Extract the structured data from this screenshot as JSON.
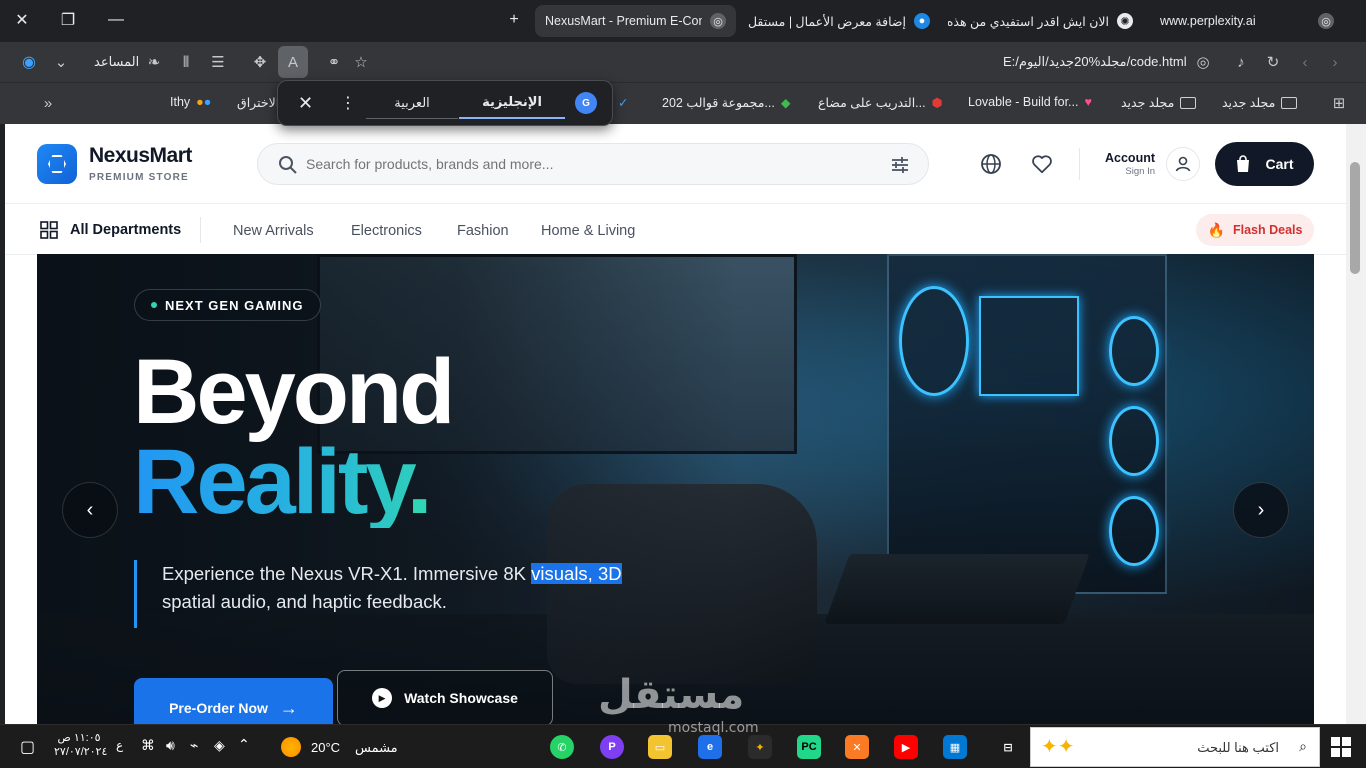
{
  "browser": {
    "tabs": [
      {
        "title": "www.perplexity.ai"
      },
      {
        "title": "الان ايش اقدر استفيدي من هذه"
      },
      {
        "title": "إضافة معرض الأعمال | مستقل"
      },
      {
        "title": "NexusMart - Premium E-Comm"
      }
    ],
    "address": "E:/مجلد%20جديد/اليوم/code.html",
    "assistant_label": "المساعد",
    "bookmarks": [
      "مجلد جديد",
      "مجلد جديد",
      "Lovable - Build for...",
      "التدريب على مضاع...",
      "مجموعة قوالب 202...",
      "الاختراق",
      "Ithy"
    ],
    "translate": {
      "active_lang": "الإنجليزية",
      "other_lang": "العربية"
    }
  },
  "site": {
    "brand": "NexusMart",
    "tagline": "PREMIUM STORE",
    "search_placeholder": "Search for products, brands and more...",
    "account_label": "Account",
    "account_sub": "Sign In",
    "cart_label": "Cart",
    "nav": {
      "departments": "All Departments",
      "links": [
        "New Arrivals",
        "Electronics",
        "Fashion",
        "Home & Living"
      ],
      "flash": "Flash Deals"
    },
    "hero": {
      "badge": "NEXT GEN GAMING",
      "title_line1": "Beyond",
      "title_line2": "Reality",
      "title_dot": ".",
      "desc_before": "Experience the Nexus VR-X1. Immersive 8K ",
      "desc_highlight": "visuals, 3D",
      "desc_after": "spatial audio, and haptic feedback.",
      "primary_cta": "Pre-Order Now",
      "secondary_cta": "Watch Showcase"
    }
  },
  "taskbar": {
    "search_placeholder": "اكتب هنا للبحث",
    "weather_temp": "20°C",
    "weather_label": "مشمس",
    "time": "١١:٠٥ ص",
    "date": "٢٧/٠٧/٢٠٢٤",
    "lang": "ع"
  },
  "watermark": {
    "text": "مستقل",
    "sub": "mostaql.com"
  },
  "colors": {
    "accent": "#1a73e8",
    "teal": "#2fd6b5",
    "dark": "#111827",
    "flash": "#e53935"
  }
}
